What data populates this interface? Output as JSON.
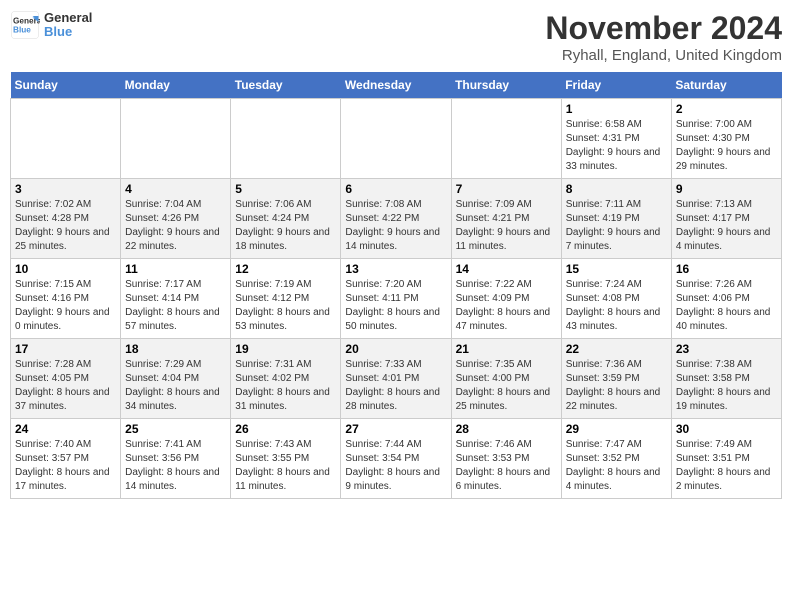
{
  "logo": {
    "line1": "General",
    "line2": "Blue"
  },
  "title": "November 2024",
  "location": "Ryhall, England, United Kingdom",
  "days_of_week": [
    "Sunday",
    "Monday",
    "Tuesday",
    "Wednesday",
    "Thursday",
    "Friday",
    "Saturday"
  ],
  "weeks": [
    [
      {
        "day": "",
        "info": ""
      },
      {
        "day": "",
        "info": ""
      },
      {
        "day": "",
        "info": ""
      },
      {
        "day": "",
        "info": ""
      },
      {
        "day": "",
        "info": ""
      },
      {
        "day": "1",
        "info": "Sunrise: 6:58 AM\nSunset: 4:31 PM\nDaylight: 9 hours and 33 minutes."
      },
      {
        "day": "2",
        "info": "Sunrise: 7:00 AM\nSunset: 4:30 PM\nDaylight: 9 hours and 29 minutes."
      }
    ],
    [
      {
        "day": "3",
        "info": "Sunrise: 7:02 AM\nSunset: 4:28 PM\nDaylight: 9 hours and 25 minutes."
      },
      {
        "day": "4",
        "info": "Sunrise: 7:04 AM\nSunset: 4:26 PM\nDaylight: 9 hours and 22 minutes."
      },
      {
        "day": "5",
        "info": "Sunrise: 7:06 AM\nSunset: 4:24 PM\nDaylight: 9 hours and 18 minutes."
      },
      {
        "day": "6",
        "info": "Sunrise: 7:08 AM\nSunset: 4:22 PM\nDaylight: 9 hours and 14 minutes."
      },
      {
        "day": "7",
        "info": "Sunrise: 7:09 AM\nSunset: 4:21 PM\nDaylight: 9 hours and 11 minutes."
      },
      {
        "day": "8",
        "info": "Sunrise: 7:11 AM\nSunset: 4:19 PM\nDaylight: 9 hours and 7 minutes."
      },
      {
        "day": "9",
        "info": "Sunrise: 7:13 AM\nSunset: 4:17 PM\nDaylight: 9 hours and 4 minutes."
      }
    ],
    [
      {
        "day": "10",
        "info": "Sunrise: 7:15 AM\nSunset: 4:16 PM\nDaylight: 9 hours and 0 minutes."
      },
      {
        "day": "11",
        "info": "Sunrise: 7:17 AM\nSunset: 4:14 PM\nDaylight: 8 hours and 57 minutes."
      },
      {
        "day": "12",
        "info": "Sunrise: 7:19 AM\nSunset: 4:12 PM\nDaylight: 8 hours and 53 minutes."
      },
      {
        "day": "13",
        "info": "Sunrise: 7:20 AM\nSunset: 4:11 PM\nDaylight: 8 hours and 50 minutes."
      },
      {
        "day": "14",
        "info": "Sunrise: 7:22 AM\nSunset: 4:09 PM\nDaylight: 8 hours and 47 minutes."
      },
      {
        "day": "15",
        "info": "Sunrise: 7:24 AM\nSunset: 4:08 PM\nDaylight: 8 hours and 43 minutes."
      },
      {
        "day": "16",
        "info": "Sunrise: 7:26 AM\nSunset: 4:06 PM\nDaylight: 8 hours and 40 minutes."
      }
    ],
    [
      {
        "day": "17",
        "info": "Sunrise: 7:28 AM\nSunset: 4:05 PM\nDaylight: 8 hours and 37 minutes."
      },
      {
        "day": "18",
        "info": "Sunrise: 7:29 AM\nSunset: 4:04 PM\nDaylight: 8 hours and 34 minutes."
      },
      {
        "day": "19",
        "info": "Sunrise: 7:31 AM\nSunset: 4:02 PM\nDaylight: 8 hours and 31 minutes."
      },
      {
        "day": "20",
        "info": "Sunrise: 7:33 AM\nSunset: 4:01 PM\nDaylight: 8 hours and 28 minutes."
      },
      {
        "day": "21",
        "info": "Sunrise: 7:35 AM\nSunset: 4:00 PM\nDaylight: 8 hours and 25 minutes."
      },
      {
        "day": "22",
        "info": "Sunrise: 7:36 AM\nSunset: 3:59 PM\nDaylight: 8 hours and 22 minutes."
      },
      {
        "day": "23",
        "info": "Sunrise: 7:38 AM\nSunset: 3:58 PM\nDaylight: 8 hours and 19 minutes."
      }
    ],
    [
      {
        "day": "24",
        "info": "Sunrise: 7:40 AM\nSunset: 3:57 PM\nDaylight: 8 hours and 17 minutes."
      },
      {
        "day": "25",
        "info": "Sunrise: 7:41 AM\nSunset: 3:56 PM\nDaylight: 8 hours and 14 minutes."
      },
      {
        "day": "26",
        "info": "Sunrise: 7:43 AM\nSunset: 3:55 PM\nDaylight: 8 hours and 11 minutes."
      },
      {
        "day": "27",
        "info": "Sunrise: 7:44 AM\nSunset: 3:54 PM\nDaylight: 8 hours and 9 minutes."
      },
      {
        "day": "28",
        "info": "Sunrise: 7:46 AM\nSunset: 3:53 PM\nDaylight: 8 hours and 6 minutes."
      },
      {
        "day": "29",
        "info": "Sunrise: 7:47 AM\nSunset: 3:52 PM\nDaylight: 8 hours and 4 minutes."
      },
      {
        "day": "30",
        "info": "Sunrise: 7:49 AM\nSunset: 3:51 PM\nDaylight: 8 hours and 2 minutes."
      }
    ]
  ]
}
